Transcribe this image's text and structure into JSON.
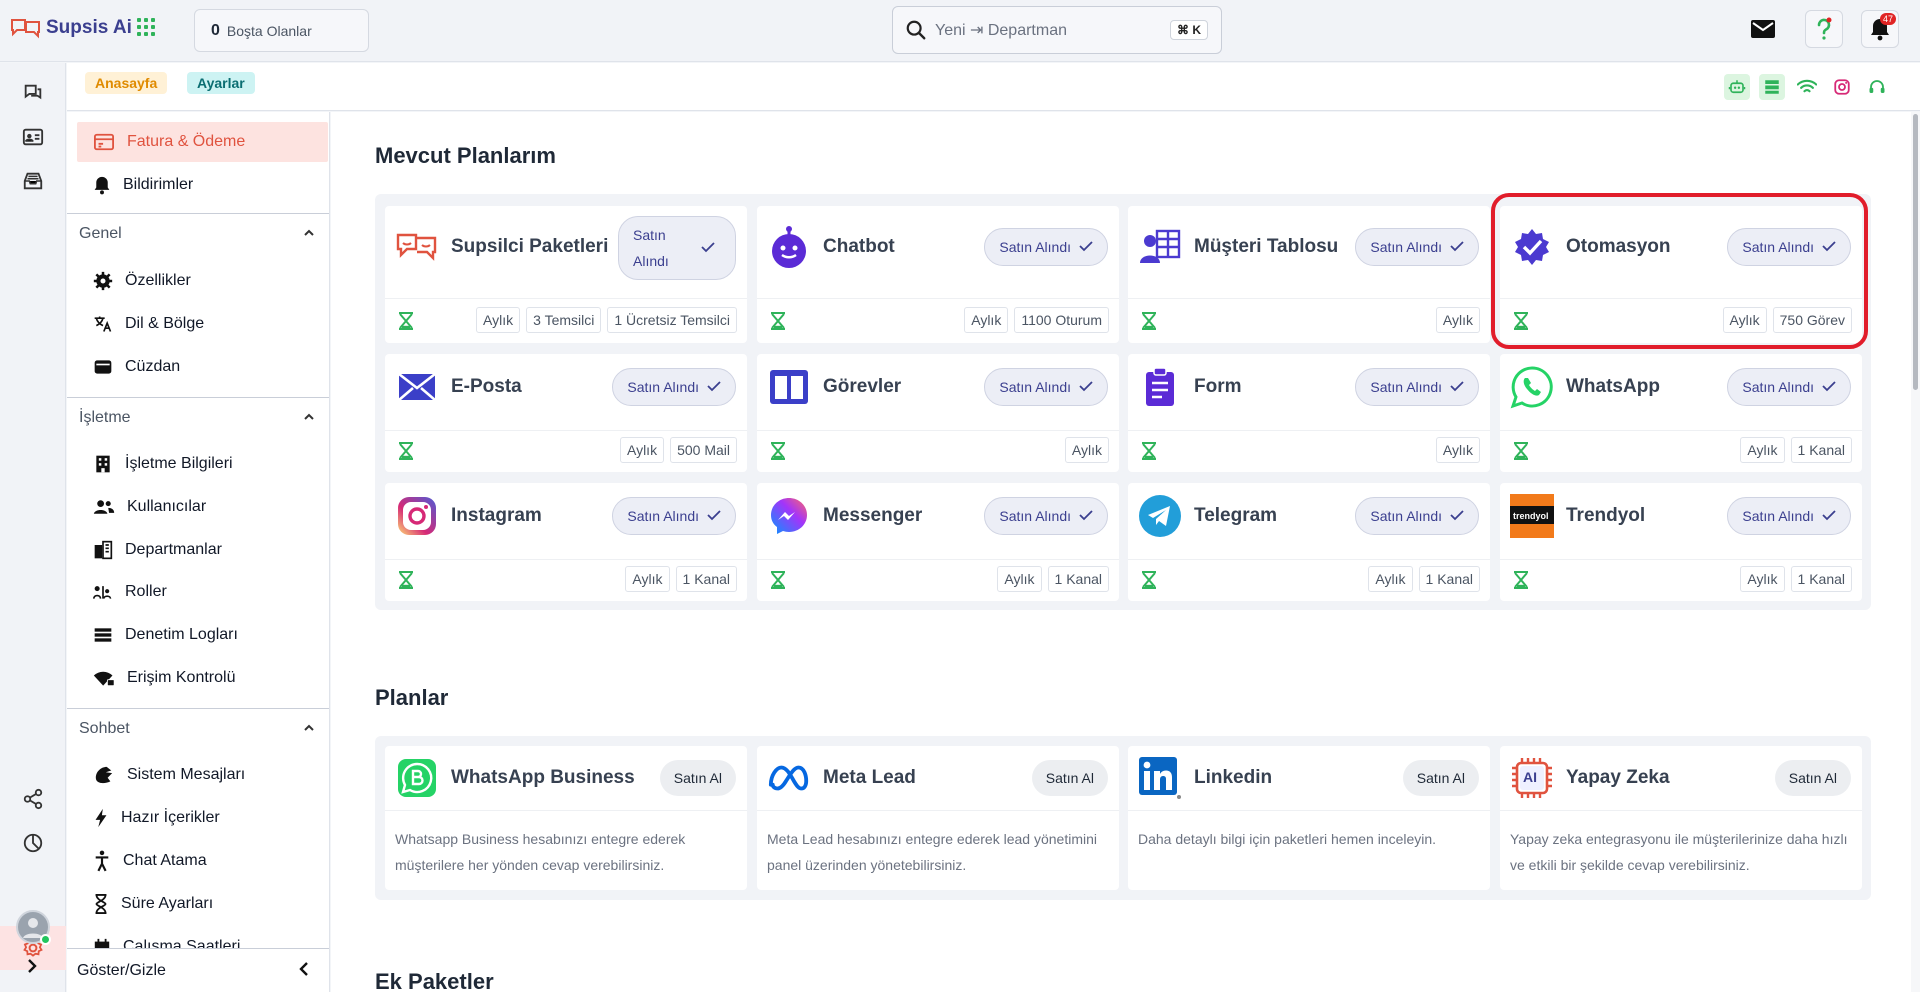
{
  "topbar": {
    "app_name": "Supsis Ai",
    "idle_count": "0",
    "idle_label": "Boşta Olanlar",
    "search_placeholder": "Yeni ⇥ Departman",
    "search_shortcut": "⌘ K",
    "notification_count": "47"
  },
  "breadcrumb": {
    "home": "Anasayfa",
    "current": "Ayarlar"
  },
  "sidebar": {
    "top_items": [
      {
        "label": "Fatura & Ödeme",
        "icon": "invoice-icon",
        "active": true
      },
      {
        "label": "Bildirimler",
        "icon": "bell-icon"
      }
    ],
    "sections": [
      {
        "title": "Genel",
        "items": [
          {
            "label": "Özellikler",
            "icon": "gear-icon"
          },
          {
            "label": "Dil & Bölge",
            "icon": "translate-icon"
          },
          {
            "label": "Cüzdan",
            "icon": "wallet-icon"
          }
        ]
      },
      {
        "title": "İşletme",
        "items": [
          {
            "label": "İşletme Bilgileri",
            "icon": "building-icon"
          },
          {
            "label": "Kullanıcılar",
            "icon": "users-icon"
          },
          {
            "label": "Departmanlar",
            "icon": "departments-icon"
          },
          {
            "label": "Roller",
            "icon": "roles-icon"
          },
          {
            "label": "Denetim Logları",
            "icon": "list-icon"
          },
          {
            "label": "Erişim Kontrolü",
            "icon": "wifi-lock-icon"
          }
        ]
      },
      {
        "title": "Sohbet",
        "items": [
          {
            "label": "Sistem Mesajları",
            "icon": "system-messages-icon"
          },
          {
            "label": "Hazır İçerikler",
            "icon": "bolt-icon"
          },
          {
            "label": "Chat Atama",
            "icon": "person-assign-icon"
          },
          {
            "label": "Süre Ayarları",
            "icon": "hourglass-icon"
          },
          {
            "label": "Çalışma Saatleri",
            "icon": "calendar-icon"
          }
        ]
      }
    ],
    "footer": "Göster/Gizle"
  },
  "current_plans": {
    "title": "Mevcut Planlarım",
    "purchased_label": "Satın Alındı",
    "cards": [
      {
        "name": "Supsilci Paketleri",
        "logo": "supsis-logo-icon",
        "tags": [
          "Aylık",
          "3 Temsilci",
          "1 Ücretsiz Temsilci"
        ]
      },
      {
        "name": "Chatbot",
        "logo": "chatbot-icon",
        "tags": [
          "Aylık",
          "1100 Oturum"
        ]
      },
      {
        "name": "Müşteri Tablosu",
        "logo": "customer-table-icon",
        "tags": [
          "Aylık"
        ]
      },
      {
        "name": "Otomasyon",
        "logo": "automation-icon",
        "tags": [
          "Aylık",
          "750 Görev"
        ]
      },
      {
        "name": "E-Posta",
        "logo": "mail-icon",
        "tags": [
          "Aylık",
          "500 Mail"
        ]
      },
      {
        "name": "Görevler",
        "logo": "tasks-board-icon",
        "tags": [
          "Aylık"
        ]
      },
      {
        "name": "Form",
        "logo": "form-clipboard-icon",
        "tags": [
          "Aylık"
        ]
      },
      {
        "name": "WhatsApp",
        "logo": "whatsapp-icon",
        "tags": [
          "Aylık",
          "1 Kanal"
        ]
      },
      {
        "name": "Instagram",
        "logo": "instagram-icon",
        "tags": [
          "Aylık",
          "1 Kanal"
        ]
      },
      {
        "name": "Messenger",
        "logo": "messenger-icon",
        "tags": [
          "Aylık",
          "1 Kanal"
        ]
      },
      {
        "name": "Telegram",
        "logo": "telegram-icon",
        "tags": [
          "Aylık",
          "1 Kanal"
        ]
      },
      {
        "name": "Trendyol",
        "logo": "trendyol-icon",
        "logo_text": "trendyol",
        "tags": [
          "Aylık",
          "1 Kanal"
        ]
      }
    ]
  },
  "plans": {
    "title": "Planlar",
    "buy_label": "Satın Al",
    "cards": [
      {
        "name": "WhatsApp Business",
        "logo": "whatsapp-business-icon",
        "desc": "Whatsapp Business hesabınızı entegre ederek müşterilere her yönden cevap verebilirsiniz."
      },
      {
        "name": "Meta Lead",
        "logo": "meta-icon",
        "desc": "Meta Lead hesabınızı entegre ederek lead yönetimini panel üzerinden yönetebilirsiniz."
      },
      {
        "name": "Linkedin",
        "logo": "linkedin-icon",
        "desc": "Daha detaylı bilgi için paketleri hemen inceleyin."
      },
      {
        "name": "Yapay Zeka",
        "logo": "ai-chip-icon",
        "logo_text": "AI",
        "desc": "Yapay zeka entegrasyonu ile müşterilerinize daha hızlı ve etkili bir şekilde cevap verebilirsiniz."
      }
    ]
  },
  "extra": {
    "title": "Ek Paketler"
  },
  "colors": {
    "accent": "#e0533f",
    "brand": "#3b3f8f",
    "highlight": "#e11d2b",
    "success": "#2fb35a"
  }
}
